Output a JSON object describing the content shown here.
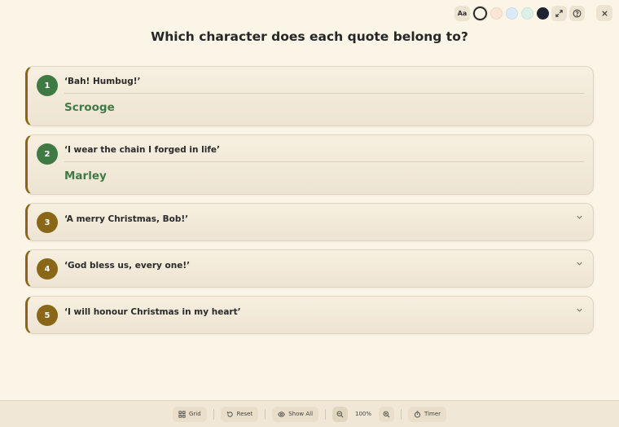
{
  "toolbar": {
    "font_button_label": "Aa",
    "swatches": [
      "#fbf5e7",
      "#fbe5d4",
      "#dce9f6",
      "#dcefe8",
      "#1e2233"
    ],
    "active_swatch": "#fbf5e7",
    "icons": [
      "font-size-icon",
      "expand-icon",
      "help-icon",
      "close-icon"
    ]
  },
  "title": "Which character does each quote belong to?",
  "quotes": [
    {
      "number": "1",
      "text": "‘Bah! Humbug!’",
      "answer": "Scrooge",
      "revealed": true
    },
    {
      "number": "2",
      "text": "‘I wear the chain I forged in life’",
      "answer": "Marley",
      "revealed": true
    },
    {
      "number": "3",
      "text": "‘A merry Christmas, Bob!’",
      "answer": "",
      "revealed": false
    },
    {
      "number": "4",
      "text": "‘God bless us, every one!’",
      "answer": "",
      "revealed": false
    },
    {
      "number": "5",
      "text": "‘I will honour Christmas in my heart’",
      "answer": "",
      "revealed": false
    }
  ],
  "colors": {
    "revealed_badge": "#3f7a45",
    "hidden_badge": "#8a6618",
    "accent_border": "#8a6516",
    "answer_text": "#3f7a45"
  },
  "bottom_bar": {
    "grid_label": "Grid",
    "reset_label": "Reset",
    "show_all_label": "Show All",
    "zoom_level": "100%",
    "timer_label": "Timer"
  }
}
